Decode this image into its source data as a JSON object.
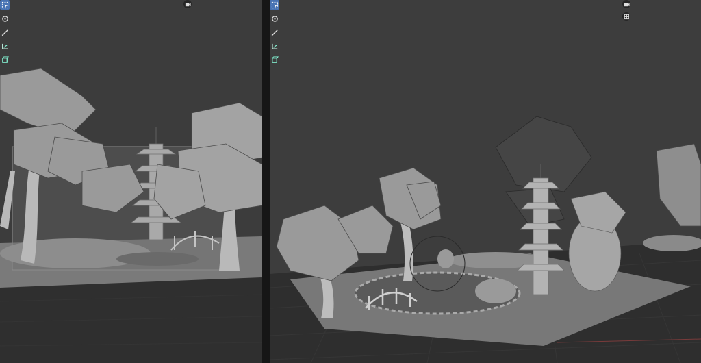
{
  "app": {
    "layout": "split-viewport",
    "background": "#3d3d3d",
    "divider_color": "#161616",
    "accent": "#4772b3"
  },
  "left_viewport": {
    "view": "camera",
    "toolbar": [
      {
        "icon": "select-box-icon",
        "active": true
      },
      {
        "icon": "cursor-icon",
        "active": false
      },
      {
        "icon": "annotate-icon",
        "active": false
      },
      {
        "icon": "measure-icon",
        "active": false
      },
      {
        "icon": "add-cube-icon",
        "active": false
      }
    ],
    "gizmo": [
      {
        "icon": "camera-view-icon"
      }
    ]
  },
  "right_viewport": {
    "view": "perspective",
    "toolbar": [
      {
        "icon": "select-box-icon",
        "active": true
      },
      {
        "icon": "cursor-icon",
        "active": false
      },
      {
        "icon": "annotate-icon",
        "active": false
      },
      {
        "icon": "measure-icon",
        "active": false
      },
      {
        "icon": "add-cube-icon",
        "active": false
      }
    ],
    "gizmo": [
      {
        "icon": "camera-view-icon"
      },
      {
        "icon": "ortho-grid-icon"
      }
    ]
  }
}
